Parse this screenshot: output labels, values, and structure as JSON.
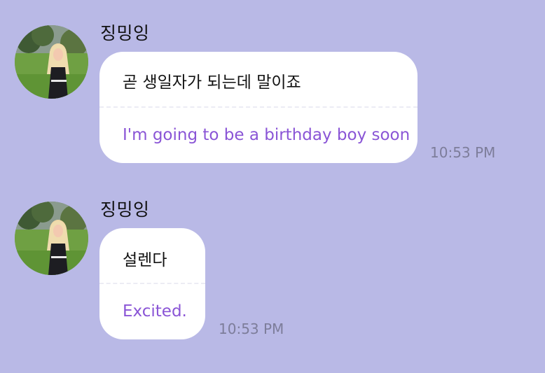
{
  "chat": {
    "messages": [
      {
        "sender": "징밍잉",
        "original": "곧 생일자가 되는데 말이죠",
        "translation": "I'm going to be a birthday boy soon",
        "time": "10:53 PM"
      },
      {
        "sender": "징밍잉",
        "original": "설렌다",
        "translation": "Excited.",
        "time": "10:53 PM"
      }
    ]
  },
  "colors": {
    "background": "#b9b9e6",
    "bubble": "#ffffff",
    "translation_text": "#8a55d6",
    "timestamp": "#7d7d9a"
  },
  "icons": {
    "avatar": "profile-photo"
  }
}
